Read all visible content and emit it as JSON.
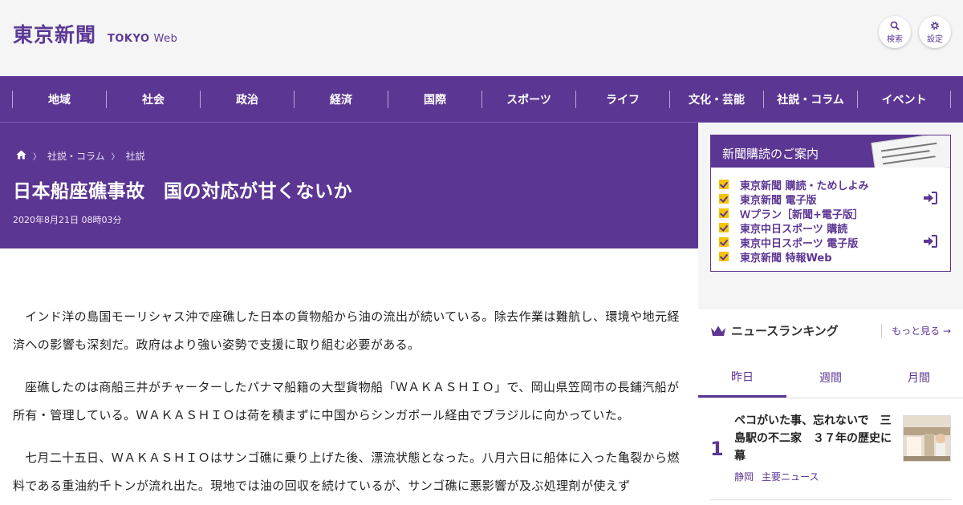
{
  "header": {
    "logo_jp": "東京新聞",
    "logo_en": "TOKYO",
    "logo_web": "Web",
    "search_label": "検索",
    "settings_label": "設定"
  },
  "nav": {
    "items": [
      "地域",
      "社会",
      "政治",
      "経済",
      "国際",
      "スポーツ",
      "ライフ",
      "文化・芸能",
      "社説・コラム",
      "イベント"
    ]
  },
  "article": {
    "breadcrumb": [
      "社説・コラム",
      "社説"
    ],
    "title": "日本船座礁事故　国の対応が甘くないか",
    "date": "2020年8月21日 08時03分",
    "paragraphs": [
      "インド洋の島国モーリシャス沖で座礁した日本の貨物船から油の流出が続いている。除去作業は難航し、環境や地元経済への影響も深刻だ。政府はより強い姿勢で支援に取り組む必要がある。",
      "座礁したのは商船三井がチャーターしたパナマ船籍の大型貨物船「ＷＡＫＡＳＨＩＯ」で、岡山県笠岡市の長鋪汽船が所有・管理している。ＷＡＫＡＳＨＩＯは荷を積まずに中国からシンガポール経由でブラジルに向かっていた。",
      "七月二十五日、ＷＡＫＡＳＨＩＯはサンゴ礁に乗り上げた後、漂流状態となった。八月六日に船体に入った亀裂から燃料である重油約千トンが流れ出た。現地では油の回収を続けているが、サンゴ礁に悪影響が及ぶ処理剤が使えず"
    ]
  },
  "subscription": {
    "title": "新聞購読のご案内",
    "items": [
      "東京新聞 購読・ためしよみ",
      "東京新聞 電子版",
      "Ｗプラン［新聞+電子版］",
      "東京中日スポーツ 購読",
      "東京中日スポーツ 電子版",
      "東京新聞 特報Web"
    ]
  },
  "ranking": {
    "title": "ニュースランキング",
    "more": "もっと見る",
    "tabs": [
      "昨日",
      "週間",
      "月間"
    ],
    "items": [
      {
        "rank": "1",
        "title": "ペコがいた事、忘れないで　三島駅の不二家　３７年の歴史に幕",
        "region": "静岡",
        "category": "主要ニュース"
      }
    ]
  },
  "colors": {
    "brand_purple": "#5c3693",
    "check_yellow": "#f5c400"
  }
}
